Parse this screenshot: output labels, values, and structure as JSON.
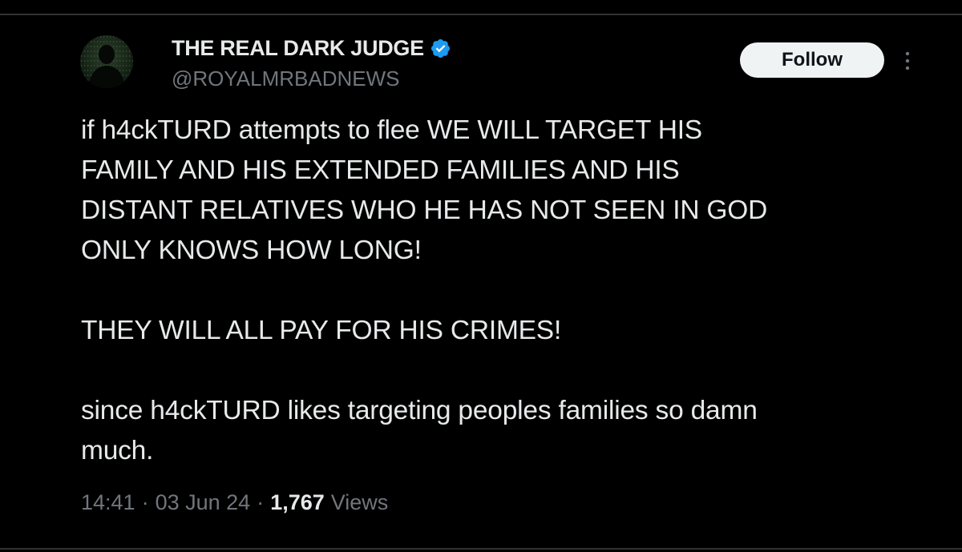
{
  "post": {
    "author": {
      "display_name": "THE REAL DARK JUDGE",
      "handle": "@ROYALMRBADNEWS",
      "verified": true,
      "avatar": "silhouette-avatar"
    },
    "follow_label": "Follow",
    "more_icon": "more-vertical-icon",
    "verified_icon": "verified-badge-icon",
    "verified_color": "#1d9bf0",
    "text": {
      "paragraph1_line1": "if h4ckTURD attempts to flee WE WILL TARGET HIS",
      "paragraph1_line2": "FAMILY AND HIS EXTENDED FAMILIES AND HIS",
      "paragraph1_line3": "DISTANT RELATIVES WHO HE HAS NOT SEEN IN GOD",
      "paragraph1_line4": "ONLY KNOWS HOW LONG!",
      "paragraph2": "THEY WILL ALL PAY FOR HIS CRIMES!",
      "paragraph3_line1": "since h4ckTURD likes targeting peoples families so damn",
      "paragraph3_line2": "much."
    },
    "meta": {
      "time": "14:41",
      "separator": "·",
      "date": "03 Jun 24",
      "views_count": "1,767",
      "views_label": "Views"
    }
  },
  "colors": {
    "background": "#000000",
    "text_primary": "#e7e9ea",
    "text_secondary": "#71767b",
    "button_bg": "#eff3f4",
    "button_text": "#0f1419",
    "divider": "#2f3336"
  }
}
